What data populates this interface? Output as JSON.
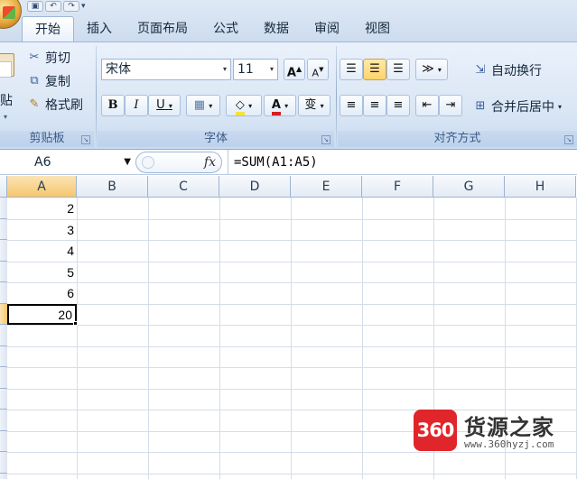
{
  "quick_access": {
    "save_icon": "save-icon",
    "undo_icon": "undo-icon",
    "redo_icon": "redo-icon",
    "customize_arrow": "▾"
  },
  "tabs": [
    {
      "label": "开始",
      "active": true
    },
    {
      "label": "插入"
    },
    {
      "label": "页面布局"
    },
    {
      "label": "公式"
    },
    {
      "label": "数据"
    },
    {
      "label": "审阅"
    },
    {
      "label": "视图"
    }
  ],
  "clipboard": {
    "paste_label": "贴",
    "cut_label": "剪切",
    "copy_label": "复制",
    "format_painter_label": "格式刷",
    "group_label": "剪贴板"
  },
  "font": {
    "font_name": "宋体",
    "font_size": "11",
    "grow_label": "A",
    "shrink_label": "A",
    "bold_label": "B",
    "italic_label": "I",
    "underline_label": "U",
    "phonetic_label": "变",
    "font_color_label": "A",
    "group_label": "字体",
    "fill_color": "#f5e23c",
    "font_color": "#d41f1f"
  },
  "alignment": {
    "wrap_text_label": "自动换行",
    "merge_center_label": "合并后居中",
    "group_label": "对齐方式"
  },
  "formula_bar": {
    "name_box": "A6",
    "fx_label": "fx",
    "formula": "=SUM(A1:A5)"
  },
  "columns": [
    "A",
    "B",
    "C",
    "D",
    "E",
    "F",
    "G",
    "H"
  ],
  "cells": [
    {
      "ref": "A1",
      "value": "2"
    },
    {
      "ref": "A2",
      "value": "3"
    },
    {
      "ref": "A3",
      "value": "4"
    },
    {
      "ref": "A4",
      "value": "5"
    },
    {
      "ref": "A5",
      "value": "6"
    },
    {
      "ref": "A6",
      "value": "20",
      "selected": true
    }
  ],
  "watermark": {
    "badge": "360",
    "title": "货源之家",
    "url": "www.360hyzj.com"
  },
  "colors": {
    "accent": "#9db6d6",
    "selection_header": "#f6c66d",
    "ribbon": "#dbe7f5"
  }
}
